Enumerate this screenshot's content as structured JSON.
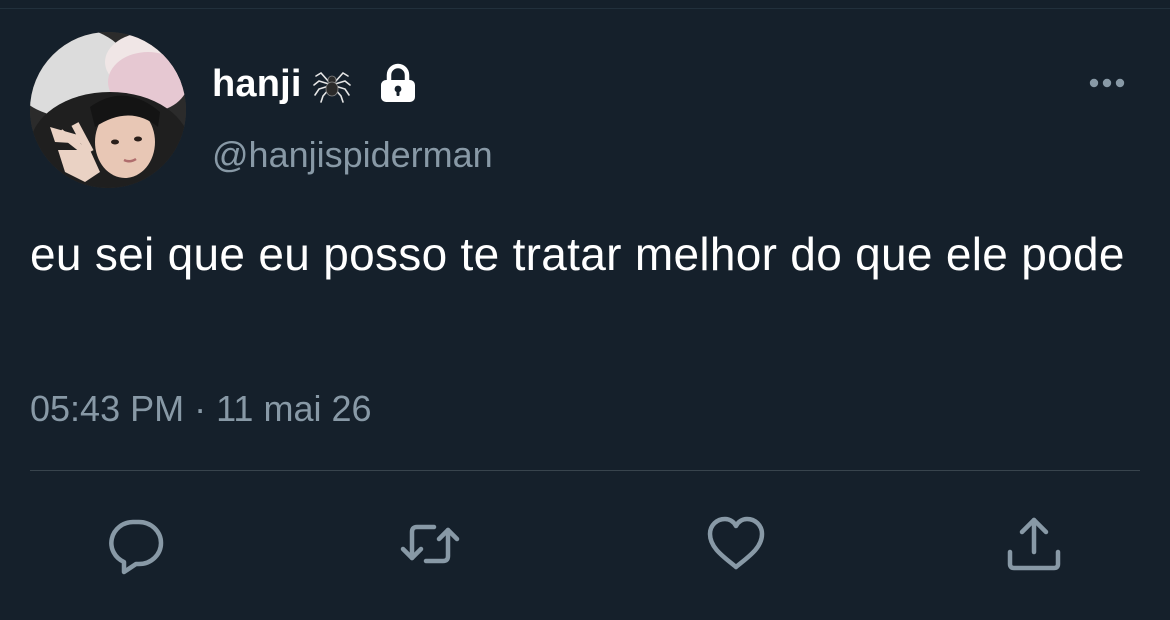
{
  "user": {
    "display_name": "hanji",
    "handle": "@hanjispiderman",
    "avatar_icon": "profile-photo",
    "name_emoji_icon": "spider-icon",
    "protected_icon": "lock-icon"
  },
  "tweet": {
    "text": "eu sei que eu posso te tratar melhor do que ele pode",
    "timestamp": "05:43 PM · 11 mai 26"
  },
  "actions": [
    {
      "name": "reply",
      "icon": "speech-bubble-icon"
    },
    {
      "name": "retweet",
      "icon": "retweet-arrows-icon"
    },
    {
      "name": "like",
      "icon": "heart-icon"
    },
    {
      "name": "share",
      "icon": "upload-icon"
    }
  ],
  "menu": {
    "icon": "more-dots-icon"
  },
  "colors": {
    "background": "#15202b",
    "primary_text": "#ffffff",
    "secondary_text": "#8899a6",
    "divider": "#38444d"
  }
}
